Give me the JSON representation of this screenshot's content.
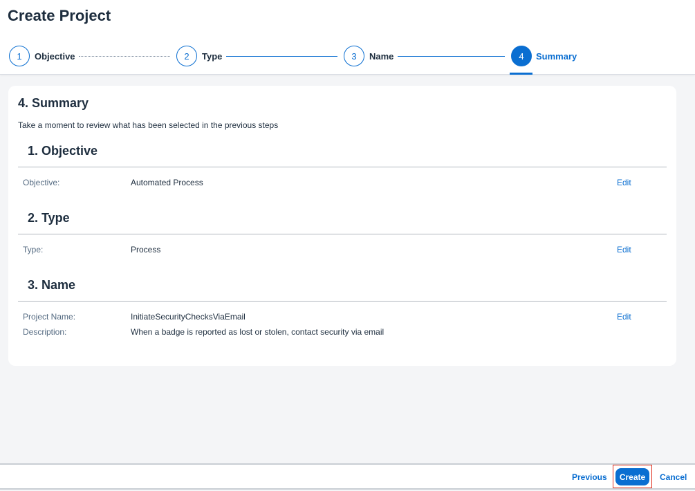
{
  "page": {
    "title": "Create Project"
  },
  "wizard": {
    "steps": [
      {
        "number": "1",
        "label": "Objective"
      },
      {
        "number": "2",
        "label": "Type"
      },
      {
        "number": "3",
        "label": "Name"
      },
      {
        "number": "4",
        "label": "Summary"
      }
    ],
    "active_step": 4
  },
  "summary": {
    "title": "4. Summary",
    "description": "Take a moment to review what has been selected in the previous steps",
    "sections": [
      {
        "title": "1. Objective",
        "edit_label": "Edit",
        "fields": [
          {
            "label": "Objective:",
            "value": "Automated Process"
          }
        ]
      },
      {
        "title": "2. Type",
        "edit_label": "Edit",
        "fields": [
          {
            "label": "Type:",
            "value": "Process"
          }
        ]
      },
      {
        "title": "3. Name",
        "edit_label": "Edit",
        "fields": [
          {
            "label": "Project Name:",
            "value": "InitiateSecurityChecksViaEmail"
          },
          {
            "label": "Description:",
            "value": "When a badge is reported as lost or stolen, contact security via email"
          }
        ]
      }
    ]
  },
  "footer": {
    "previous_label": "Previous",
    "create_label": "Create",
    "cancel_label": "Cancel"
  },
  "colors": {
    "accent": "#0a6ed1",
    "background": "#f4f5f7",
    "text": "#1d2d3e",
    "highlight": "#e0301e"
  }
}
